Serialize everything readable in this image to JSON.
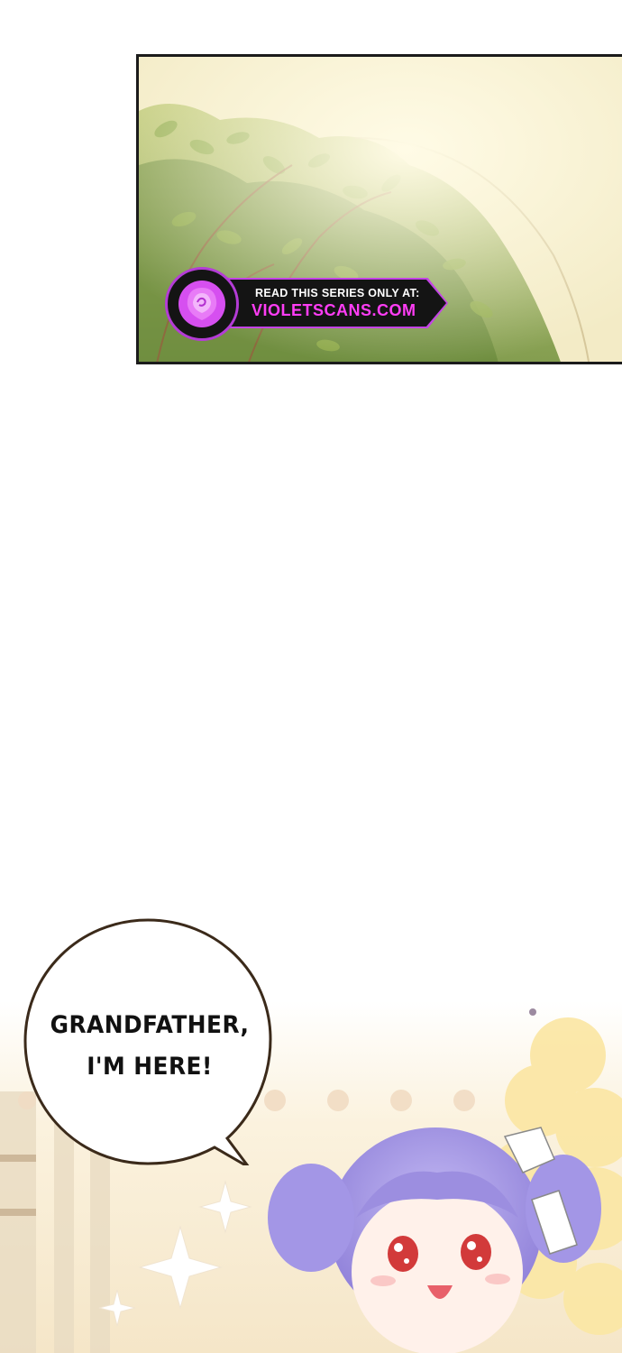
{
  "watermark": {
    "line1": "READ THIS SERIES ONLY AT:",
    "line2": "VIOLETSCANS.COM",
    "logo_icon": "rose-icon",
    "accent": "#c443e6",
    "text_accent": "#ff3df5"
  },
  "speech_bubble": {
    "line1": "GRANDFATHER,",
    "line2": "I'M HERE!"
  },
  "colors": {
    "foliage": "#7a9a3c",
    "sky_glow": "#f4ecc8",
    "hair": "#a79be6",
    "flowers": "#fbe7a6"
  }
}
